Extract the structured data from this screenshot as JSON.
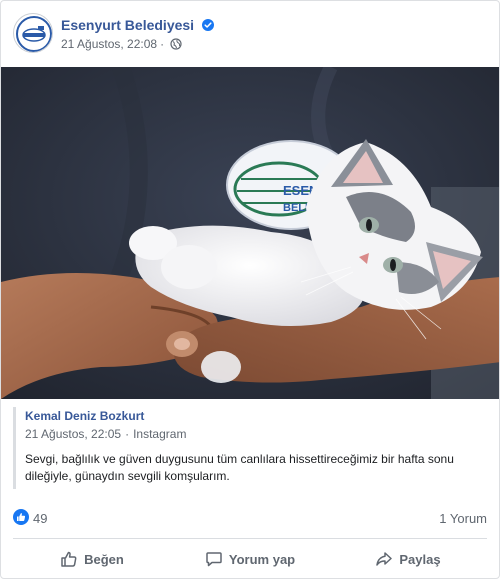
{
  "post": {
    "author": "Esenyurt Belediyesi",
    "timestamp": "21 Ağustos, 22:08",
    "privacy_icon": "globe-icon",
    "verified_icon": "verified-badge-icon",
    "brand_color": "#385898"
  },
  "shared": {
    "author": "Kemal Deniz Bozkurt",
    "timestamp": "21 Ağustos, 22:05",
    "source": "Instagram",
    "text": "Sevgi, bağlılık ve güven duygusunu tüm canlılara hissettireceğimiz bir hafta sonu dileğiyle, günaydın sevgili komşularım."
  },
  "stats": {
    "likes": "49",
    "comments": "1 Yorum"
  },
  "actions": {
    "like": "Beğen",
    "comment": "Yorum yap",
    "share": "Paylaş"
  }
}
